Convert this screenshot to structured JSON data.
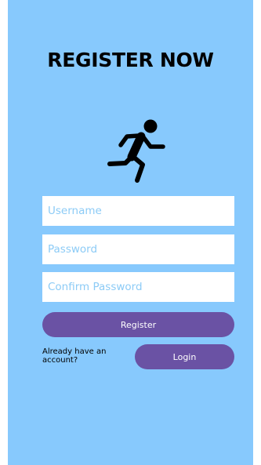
{
  "header": {
    "title": "REGISTER NOW"
  },
  "logo": {
    "icon": "running-person-icon"
  },
  "form": {
    "username_placeholder": "Username",
    "password_placeholder": "Password",
    "confirm_password_placeholder": "Confirm Password",
    "register_label": "Register"
  },
  "footer": {
    "account_text": "Already have an account?",
    "login_label": "Login"
  },
  "colors": {
    "background": "#87c9fd",
    "button": "#6a52a4",
    "placeholder": "#8ccbf6"
  }
}
